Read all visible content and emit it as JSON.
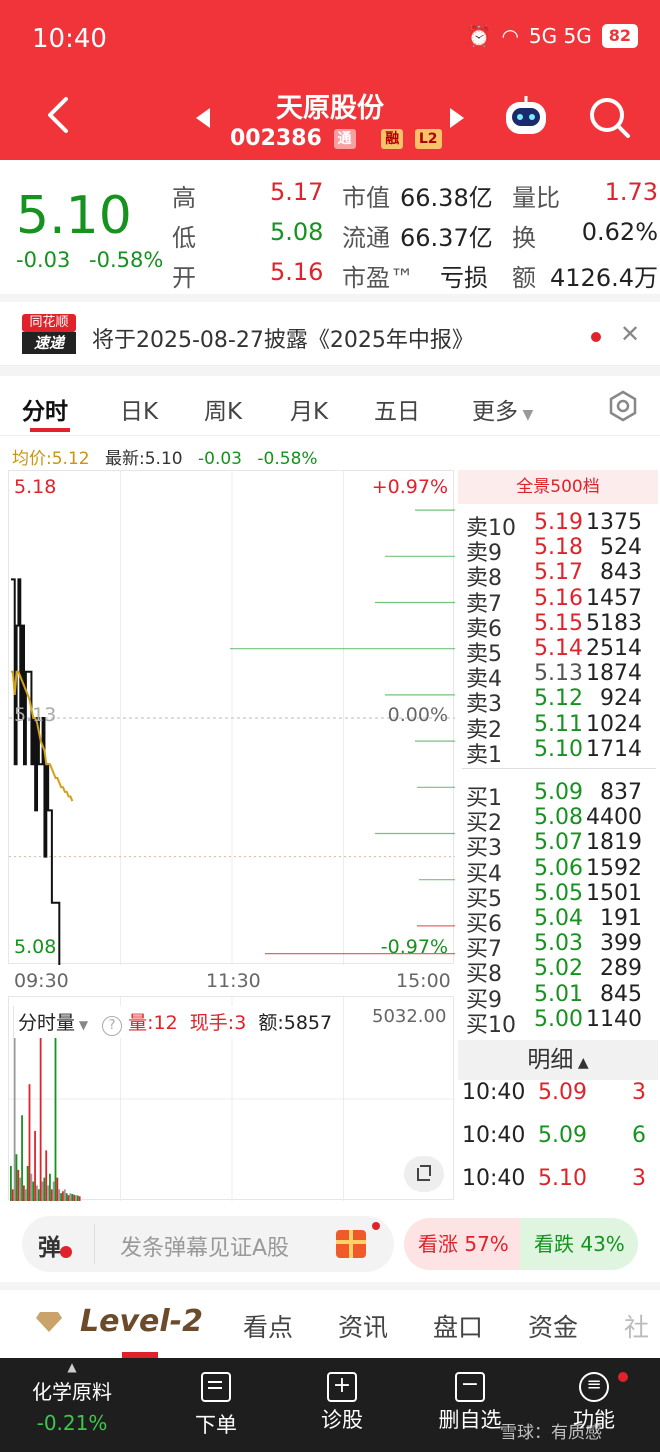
{
  "status_bar": {
    "time": "10:40",
    "network": "5G 5G",
    "battery": "82"
  },
  "header": {
    "title": "天原股份",
    "code": "002386",
    "tags": [
      "通",
      "融",
      "L2"
    ]
  },
  "quote": {
    "price": "5.10",
    "change": "-0.03",
    "change_pct": "-0.58%",
    "high_label": "高",
    "high": "5.17",
    "low_label": "低",
    "low": "5.08",
    "open_label": "开",
    "open": "5.16",
    "mktcap_label": "市值",
    "mktcap": "66.38亿",
    "float_label": "流通",
    "float": "66.37亿",
    "pe_label": "市盈™",
    "pe": "亏损",
    "volratio_label": "量比",
    "volratio": "1.73",
    "turnover_label": "换",
    "turnover": "0.62%",
    "amount_label": "额",
    "amount": "4126.4万"
  },
  "notice": {
    "logo_top": "同花顺",
    "logo_bottom": "速递",
    "text": "将于2025-08-27披露《2025年中报》"
  },
  "tabs": [
    "分时",
    "日K",
    "周K",
    "月K",
    "五日",
    "更多"
  ],
  "chart_info": {
    "avg": "均价:5.12",
    "latest": "最新:5.10",
    "chg": "-0.03",
    "pct": "-0.58%"
  },
  "chart_axis": {
    "top": "5.18",
    "mid": "5.13",
    "bottom": "5.08",
    "top_pct": "+0.97%",
    "mid_pct": "0.00%",
    "bottom_pct": "-0.97%",
    "t_start": "09:30",
    "t_mid": "11:30",
    "t_end": "15:00"
  },
  "volume_info": {
    "label": "分时量",
    "vol": "量:12",
    "now": "现手:3",
    "amt": "额:5857",
    "max": "5032.00"
  },
  "orderbook": {
    "title": "全景500档",
    "sell": [
      {
        "label": "卖10",
        "price": "5.19",
        "vol": "1375",
        "color": "red"
      },
      {
        "label": "卖9",
        "price": "5.18",
        "vol": "524",
        "color": "red"
      },
      {
        "label": "卖8",
        "price": "5.17",
        "vol": "843",
        "color": "red"
      },
      {
        "label": "卖7",
        "price": "5.16",
        "vol": "1457",
        "color": "red"
      },
      {
        "label": "卖6",
        "price": "5.15",
        "vol": "5183",
        "color": "red"
      },
      {
        "label": "卖5",
        "price": "5.14",
        "vol": "2514",
        "color": "red"
      },
      {
        "label": "卖4",
        "price": "5.13",
        "vol": "1874",
        "color": "gray"
      },
      {
        "label": "卖3",
        "price": "5.12",
        "vol": "924",
        "color": "green"
      },
      {
        "label": "卖2",
        "price": "5.11",
        "vol": "1024",
        "color": "green"
      },
      {
        "label": "卖1",
        "price": "5.10",
        "vol": "1714",
        "color": "green"
      }
    ],
    "buy": [
      {
        "label": "买1",
        "price": "5.09",
        "vol": "837",
        "color": "green"
      },
      {
        "label": "买2",
        "price": "5.08",
        "vol": "4400",
        "color": "green"
      },
      {
        "label": "买3",
        "price": "5.07",
        "vol": "1819",
        "color": "green"
      },
      {
        "label": "买4",
        "price": "5.06",
        "vol": "1592",
        "color": "green"
      },
      {
        "label": "买5",
        "price": "5.05",
        "vol": "1501",
        "color": "green"
      },
      {
        "label": "买6",
        "price": "5.04",
        "vol": "191",
        "color": "green"
      },
      {
        "label": "买7",
        "price": "5.03",
        "vol": "399",
        "color": "green"
      },
      {
        "label": "买8",
        "price": "5.02",
        "vol": "289",
        "color": "green"
      },
      {
        "label": "买9",
        "price": "5.01",
        "vol": "845",
        "color": "green"
      },
      {
        "label": "买10",
        "price": "5.00",
        "vol": "1140",
        "color": "green"
      }
    ]
  },
  "detail": {
    "title": "明细",
    "rows": [
      {
        "time": "10:40",
        "price": "5.09",
        "vol": "3",
        "color": "red"
      },
      {
        "time": "10:40",
        "price": "5.09",
        "vol": "6",
        "color": "green"
      },
      {
        "time": "10:40",
        "price": "5.10",
        "vol": "3",
        "color": "red"
      }
    ]
  },
  "danmu": {
    "icon": "弹",
    "placeholder": "发条弹幕见证A股",
    "up": "看涨 57%",
    "down": "看跌 43%"
  },
  "bottom_tabs": [
    "Level-2",
    "看点",
    "资讯",
    "盘口",
    "资金",
    "社"
  ],
  "bottom_nav": {
    "sector": "化学原料",
    "sector_pct": "-0.21%",
    "items": [
      "下单",
      "诊股",
      "删自选",
      "功能"
    ],
    "watermark": "雪球：有质感"
  },
  "colors": {
    "brand": "#f0343a",
    "up": "#e0232b",
    "down": "#16921f",
    "avg_line": "#d4a017"
  },
  "chart_data": {
    "type": "line",
    "title": "",
    "series": [
      {
        "name": "最新",
        "values": [
          5.16,
          5.16,
          5.12,
          5.15,
          5.16,
          5.13,
          5.15,
          5.12,
          5.14,
          5.14,
          5.14,
          5.12,
          5.13,
          5.11,
          5.13,
          5.12,
          5.12,
          5.13,
          5.1,
          5.12,
          5.11,
          5.11,
          5.09,
          5.09,
          5.09,
          5.09,
          5.07,
          5.06,
          5.07,
          5.07,
          5.07,
          5.06,
          5.07,
          5.07,
          5.06,
          5.06,
          5.06,
          5.07
        ]
      },
      {
        "name": "均价",
        "values": [
          5.14,
          5.14,
          5.135,
          5.14,
          5.14,
          5.139,
          5.138,
          5.137,
          5.136,
          5.135,
          5.134,
          5.132,
          5.13,
          5.13,
          5.129,
          5.127,
          5.125,
          5.124,
          5.123,
          5.12,
          5.12,
          5.12,
          5.119,
          5.118,
          5.117,
          5.117,
          5.116,
          5.115,
          5.115,
          5.114,
          5.114,
          5.113,
          5.113,
          5.112
        ]
      }
    ],
    "ylim": [
      5.08,
      5.18
    ],
    "prev_close": 5.13,
    "xlabel_ticks": [
      "09:30",
      "11:30",
      "15:00"
    ],
    "volume": [
      900,
      300,
      5000,
      1200,
      800,
      600,
      2200,
      400,
      300,
      900,
      3000,
      700,
      500,
      1800,
      400,
      300,
      5000,
      500,
      600,
      1300,
      400,
      700,
      300,
      500,
      4500,
      600,
      300,
      200,
      250,
      300,
      200,
      150,
      200,
      180,
      160,
      150,
      140,
      120
    ]
  }
}
